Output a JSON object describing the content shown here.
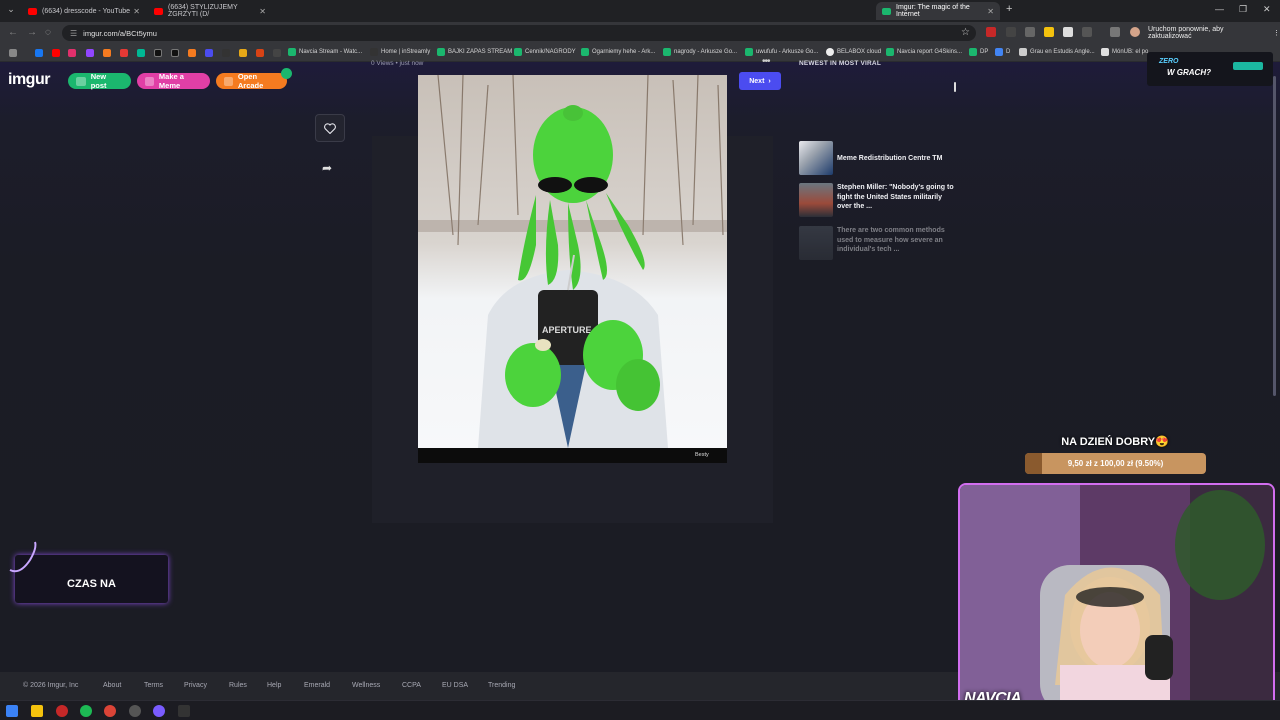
{
  "browser": {
    "tabs": [
      {
        "label": "(6634) dresscode - YouTube",
        "favicon_color": "#ff0000"
      },
      {
        "label": "(6634) STYLIZUJEMY ZGRZYTI (D/",
        "favicon_color": "#ff0000"
      },
      {
        "label": "Imgur: The magic of the Internet",
        "favicon_color": "#1bb76e",
        "active": true
      }
    ],
    "url": "imgur.com/a/BCt5ymu",
    "update_button": "Uruchom ponownie, aby zaktualizować"
  },
  "bookmarks": [
    {
      "label": "Navcia Stream - Watc...",
      "color": "#1bb76e"
    },
    {
      "label": "Home | inStreamly",
      "color": "#333333"
    },
    {
      "label": "BAJKI ZAPAS STREAM",
      "color": "#1bb76e"
    },
    {
      "label": "Cennik/NAGRODY",
      "color": "#1bb76e"
    },
    {
      "label": "Ogarniemy hehe - Ark...",
      "color": "#1bb76e"
    },
    {
      "label": "nagrody - Arkusze Go...",
      "color": "#1bb76e"
    },
    {
      "label": "uwufufu - Arkusze Go...",
      "color": "#1bb76e"
    },
    {
      "label": "BELABOX cloud",
      "color": "#eeeeee"
    },
    {
      "label": "Navcia report G4Skins...",
      "color": "#1bb76e"
    },
    {
      "label": "DP",
      "color": "#1bb76e"
    },
    {
      "label": "D",
      "color": "#4285f4"
    },
    {
      "label": "Grau en Estudis Angle...",
      "color": "#cccccc"
    },
    {
      "label": "MónUB: el po",
      "color": "#e0e0e0"
    }
  ],
  "imgur": {
    "logo": "imgur",
    "new_post": "New post",
    "make_meme": "Make a Meme",
    "open_arcade": "Open Arcade",
    "next": "Next",
    "post_meta": "0 Views • just now",
    "image_watermark": "Besty",
    "sidebar_title": "NEWEST IN MOST VIRAL",
    "viral_posts": [
      {
        "title": "Meme Redistribution Centre TM"
      },
      {
        "title": "Stephen Miller: \"Nobody's going to fight the United States militarily over the ..."
      },
      {
        "title": "There are two common methods used to measure how severe an individual's tech ..."
      }
    ],
    "footer": {
      "copyright": "© 2026 Imgur, Inc",
      "links": [
        "About",
        "Terms",
        "Privacy",
        "Rules",
        "Help",
        "Emerald",
        "Wellness",
        "CCPA",
        "EU DSA",
        "Trending"
      ]
    }
  },
  "stream": {
    "goal_title": "NA DZIEŃ DOBRY😍",
    "goal_text": "9,50 zł z 100,00 zł (9.50%)",
    "goal_progress": 0.095,
    "czas_label": "CZAS NA",
    "zero_line1": "ZERO",
    "zero_line2": "W GRACH?",
    "cam_name": "NAVCIA",
    "accent": "#d26ef0"
  }
}
